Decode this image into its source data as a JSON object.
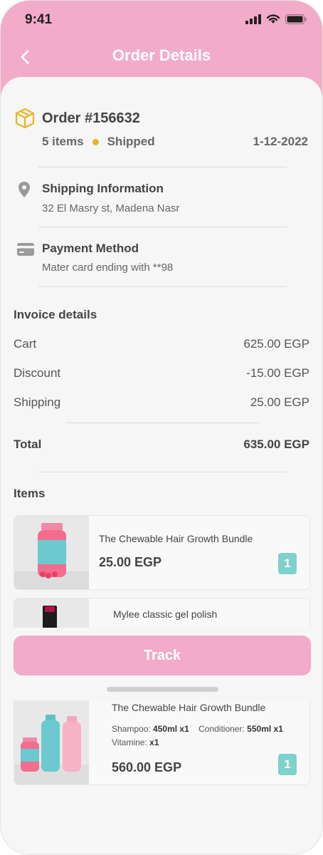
{
  "status_bar": {
    "time": "9:41"
  },
  "header": {
    "title": "Order Details"
  },
  "order": {
    "number": "Order #156632",
    "items_count": "5 items",
    "status": "Shipped",
    "date": "1-12-2022",
    "status_color": "#e8b522"
  },
  "shipping": {
    "title": "Shipping Information",
    "address": "32 El Masry st, Madena Nasr"
  },
  "payment": {
    "title": "Payment Method",
    "detail": "Mater card ending with **98"
  },
  "invoice": {
    "title": "Invoice details",
    "rows": [
      {
        "label": "Cart",
        "value": "625.00 EGP"
      },
      {
        "label": "Discount",
        "value": "-15.00 EGP"
      },
      {
        "label": "Shipping",
        "value": "25.00 EGP"
      }
    ],
    "total_label": "Total",
    "total_value": "635.00 EGP"
  },
  "items": {
    "title": "Items",
    "list": [
      {
        "name": "The Chewable Hair Growth Bundle",
        "price": "25.00 EGP",
        "qty": "1"
      },
      {
        "name": "Mylee classic gel polish"
      }
    ]
  },
  "track_button": {
    "label": "Track"
  },
  "bundle": {
    "name": "The Chewable Hair Growth Bundle",
    "shampoo_label": "Shampoo:",
    "shampoo_value": "450ml x1",
    "conditioner_label": "Conditioner:",
    "conditioner_value": "550ml x1",
    "vitamine_label": "Vitamine:",
    "vitamine_value": "x1",
    "price": "560.00 EGP",
    "qty": "1"
  },
  "colors": {
    "accent_pink": "#f2abc8",
    "qty_badge": "#7fd1cc",
    "order_icon": "#e8b522"
  }
}
